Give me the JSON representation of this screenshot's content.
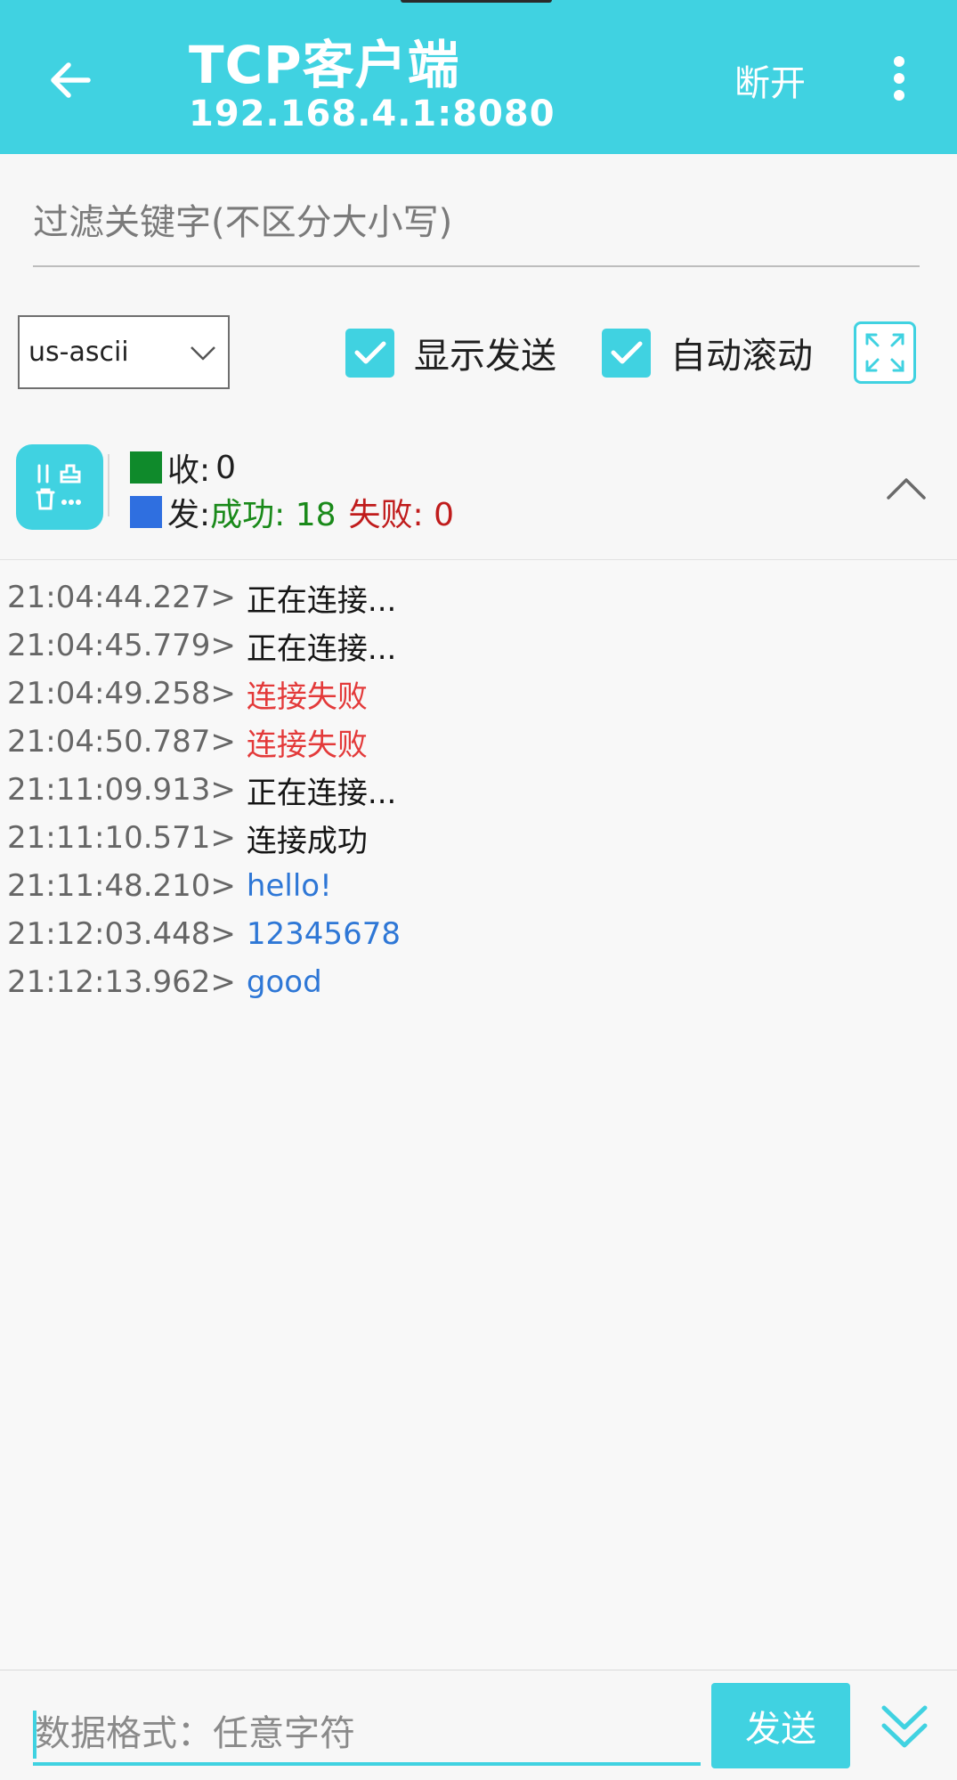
{
  "header": {
    "title": "TCP客户端",
    "subtitle": "192.168.4.1:8080",
    "disconnect_label": "断开",
    "back_icon": "arrow-left-icon",
    "more_icon": "more-vertical-icon"
  },
  "filter": {
    "placeholder": "过滤关键字(不区分大小写)",
    "value": ""
  },
  "options": {
    "encoding": "us-ascii",
    "show_send": {
      "label": "显示发送",
      "checked": true
    },
    "auto_scroll": {
      "label": "自动滚动",
      "checked": true
    },
    "fullscreen_icon": "fullscreen-icon"
  },
  "stats": {
    "received_label": "收:",
    "received_count": "0",
    "sent_label": "发:",
    "success_label": "成功: 18",
    "fail_label": "失败: 0",
    "received_color": "#0f8a2b",
    "sent_color": "#2f6fe0"
  },
  "log": [
    {
      "time": "21:04:44.227>",
      "message": "正在连接...",
      "kind": "normal"
    },
    {
      "time": "21:04:45.779>",
      "message": "正在连接...",
      "kind": "normal"
    },
    {
      "time": "21:04:49.258>",
      "message": "连接失败",
      "kind": "error"
    },
    {
      "time": "21:04:50.787>",
      "message": "连接失败",
      "kind": "error"
    },
    {
      "time": "21:11:09.913>",
      "message": "正在连接...",
      "kind": "normal"
    },
    {
      "time": "21:11:10.571>",
      "message": "连接成功",
      "kind": "normal"
    },
    {
      "time": "21:11:48.210>",
      "message": "hello!",
      "kind": "sent"
    },
    {
      "time": "21:12:03.448>",
      "message": "12345678",
      "kind": "sent"
    },
    {
      "time": "21:12:13.962>",
      "message": "good",
      "kind": "sent"
    }
  ],
  "send": {
    "placeholder": "数据格式：任意字符",
    "value": "",
    "button_label": "发送"
  },
  "colors": {
    "accent": "#40d2e1",
    "error": "#e33a3a",
    "sent": "#2e77d6"
  }
}
